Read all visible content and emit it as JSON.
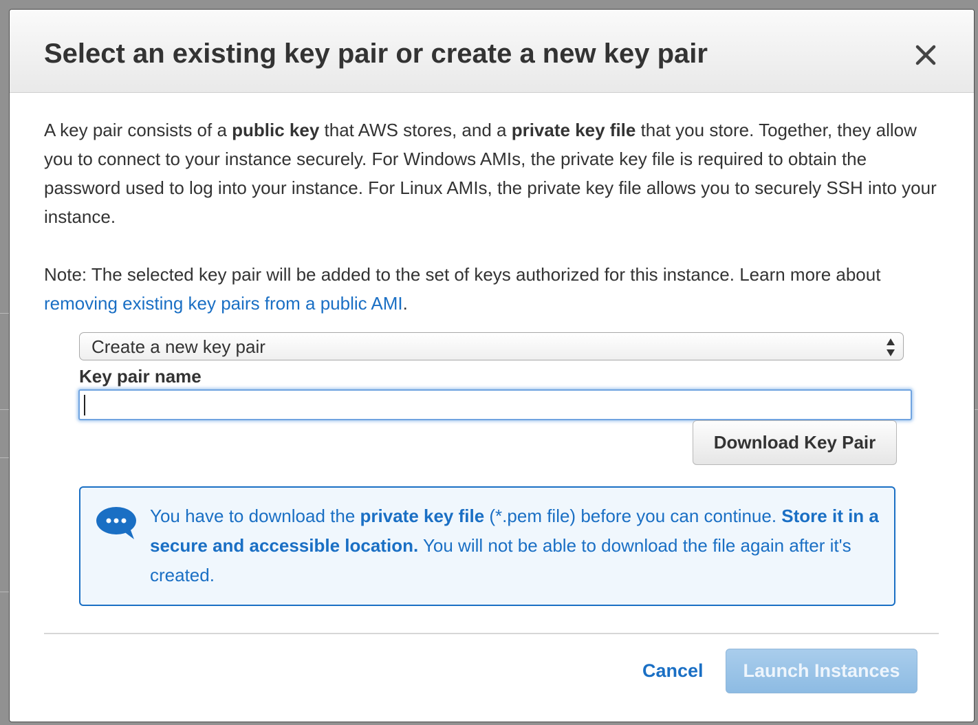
{
  "dialog": {
    "title": "Select an existing key pair or create a new key pair",
    "close_icon": "close-icon"
  },
  "intro": {
    "p1": "A key pair consists of a ",
    "b1": "public key",
    "p2": " that AWS stores, and a ",
    "b2": "private key file",
    "p3": " that you store. Together, they allow you to connect to your instance securely. For Windows AMIs, the private key file is required to obtain the password used to log into your instance. For Linux AMIs, the private key file allows you to securely SSH into your instance."
  },
  "note": {
    "prefix": "Note: The selected key pair will be added to the set of keys authorized for this instance. Learn more about ",
    "link": "removing existing key pairs from a public AMI",
    "suffix": "."
  },
  "key_pair_select": {
    "selected": "Create a new key pair"
  },
  "key_pair_name": {
    "label": "Key pair name",
    "value": "",
    "placeholder": ""
  },
  "download_button": "Download Key Pair",
  "info": {
    "icon": "chat-bubble-icon",
    "t1": "You have to download the ",
    "b1": "private key file",
    "t2": " (*.pem file) before you can continue. ",
    "b2": "Store it in a secure and accessible location.",
    "t3": " You will not be able to download the file again after it's created."
  },
  "footer": {
    "cancel": "Cancel",
    "launch": "Launch Instances"
  },
  "colors": {
    "link": "#1a6fc4",
    "info_background": "#f0f7fd",
    "launch_disabled": "#9cc4e8",
    "focus_ring": "#6fa3e0"
  }
}
